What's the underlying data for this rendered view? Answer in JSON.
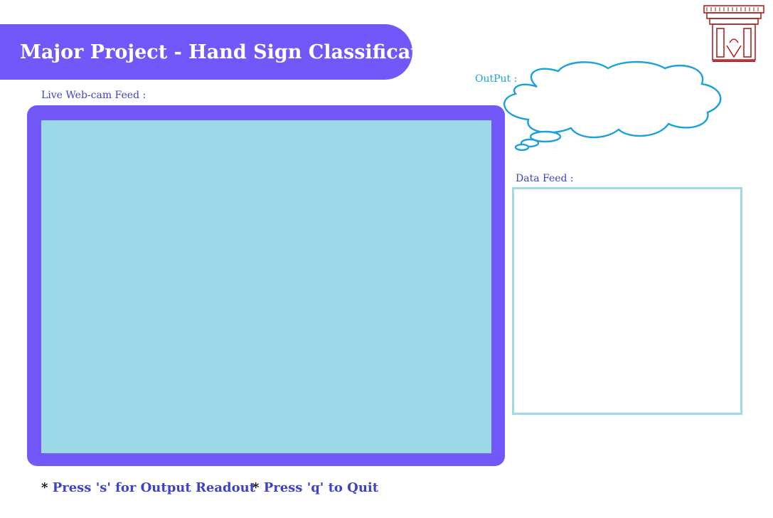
{
  "header": {
    "title": "Major Project - Hand Sign Classification"
  },
  "webcam": {
    "label": "Live Web-cam Feed :"
  },
  "output": {
    "label": "OutPut :"
  },
  "data_feed": {
    "label": "Data Feed :"
  },
  "instructions": [
    {
      "bullet": "*",
      "text": "Press 's' for Output Readout"
    },
    {
      "bullet": "*",
      "text": "Press 'q' to Quit"
    }
  ],
  "colors": {
    "banner": "#7258f8",
    "webcam_frame": "#7258f8",
    "webcam_view": "#9bd9e9",
    "label_text": "#3d42c8",
    "output_label": "#1ba2d6",
    "cloud_stroke": "#1aa0dc",
    "data_box_border": "#a0dae4",
    "logo": "#b22222"
  },
  "icons": {
    "logo": "university-logo-icon",
    "cloud": "thought-cloud-icon"
  }
}
